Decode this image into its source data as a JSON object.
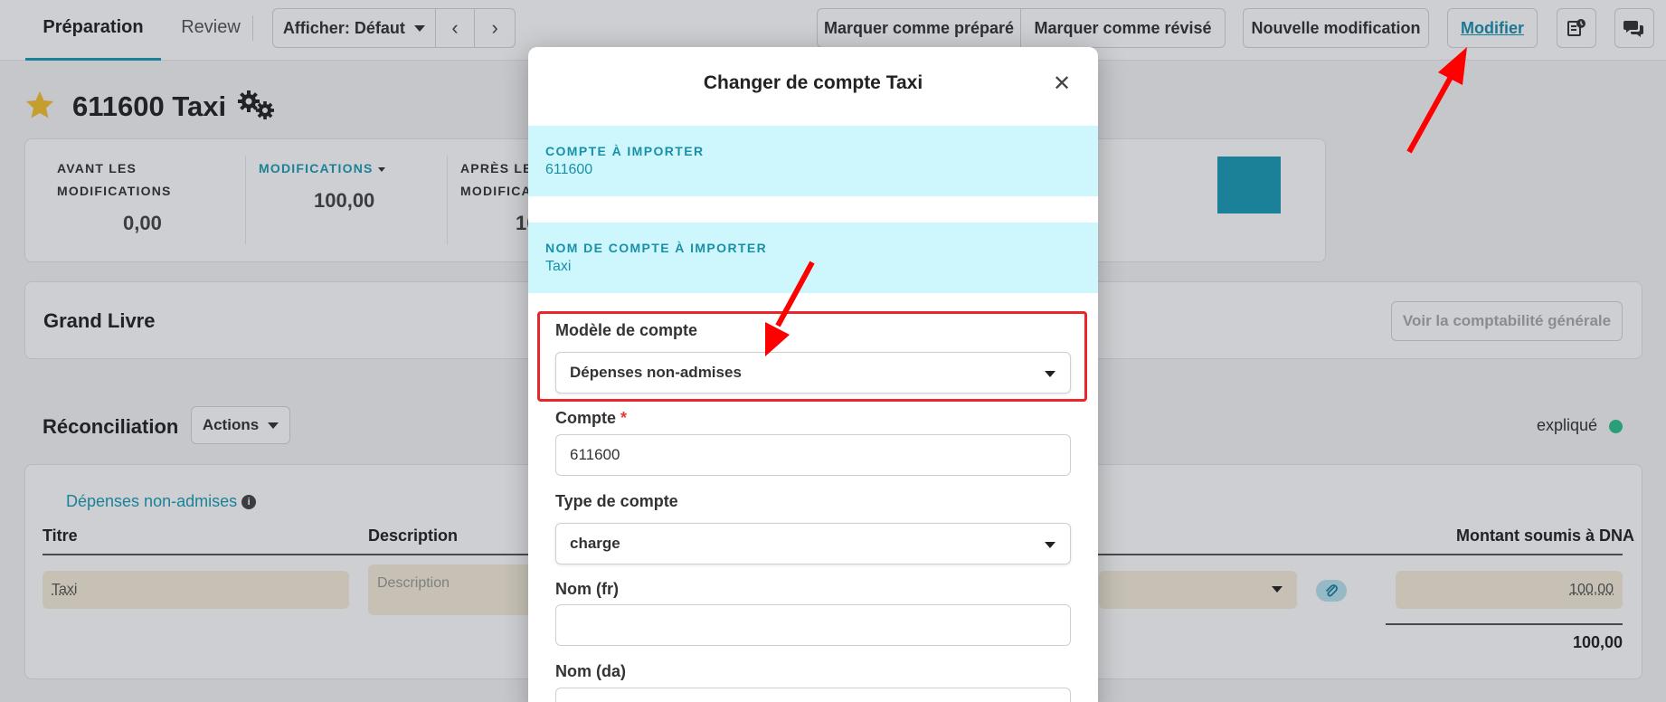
{
  "topbar": {
    "tabs": [
      {
        "label": "Préparation"
      },
      {
        "label": "Review"
      }
    ],
    "view_label": "Afficher: Défaut",
    "prev_icon": "chevron-left-icon",
    "next_icon": "chevron-right-icon",
    "mark_prepared": "Marquer comme préparé",
    "mark_reviewed": "Marquer comme révisé",
    "new_modification": "Nouvelle modification",
    "modify": "Modifier",
    "history_icon": "history-icon",
    "chat_icon": "chat-icon"
  },
  "account": {
    "title": "611600 Taxi",
    "star_icon": "star-icon",
    "settings_icon": "gears-icon"
  },
  "stats": {
    "before_label_1": "AVANT LES",
    "before_label_2": "MODIFICATIONS",
    "before_value": "0,00",
    "modifications_label": "MODIFICATIONS",
    "modifications_value": "100,00",
    "after_label_1": "APRÈS LES",
    "after_label_2": "MODIFICA",
    "after_value_partial": "10",
    "accent_color": "#1a9cb5"
  },
  "ledger": {
    "title": "Grand Livre",
    "button": "Voir la comptabilité générale"
  },
  "reconciliation": {
    "title": "Réconciliation",
    "actions_label": "Actions",
    "status": "expliqué",
    "status_color": "#2ec08c",
    "group_link": "Dépenses non-admises",
    "columns": {
      "title": "Titre",
      "description": "Description",
      "amount": "Montant soumis à DNA"
    },
    "row": {
      "title": "Taxi",
      "description_placeholder": "Description",
      "amount": "100,00"
    },
    "total": "100,00"
  },
  "modal": {
    "title": "Changer de compte Taxi",
    "account_to_import_label": "COMPTE À IMPORTER",
    "account_to_import_value": "611600",
    "account_name_label": "NOM DE COMPTE À IMPORTER",
    "account_name_value": "Taxi",
    "template_label": "Modèle de compte",
    "template_value": "Dépenses non-admises",
    "account_label": "Compte",
    "required_mark": "*",
    "account_value": "611600",
    "type_label": "Type de compte",
    "type_value": "charge",
    "name_fr_label": "Nom (fr)",
    "name_fr_value": "",
    "name_da_label": "Nom (da)",
    "name_da_value": ""
  }
}
